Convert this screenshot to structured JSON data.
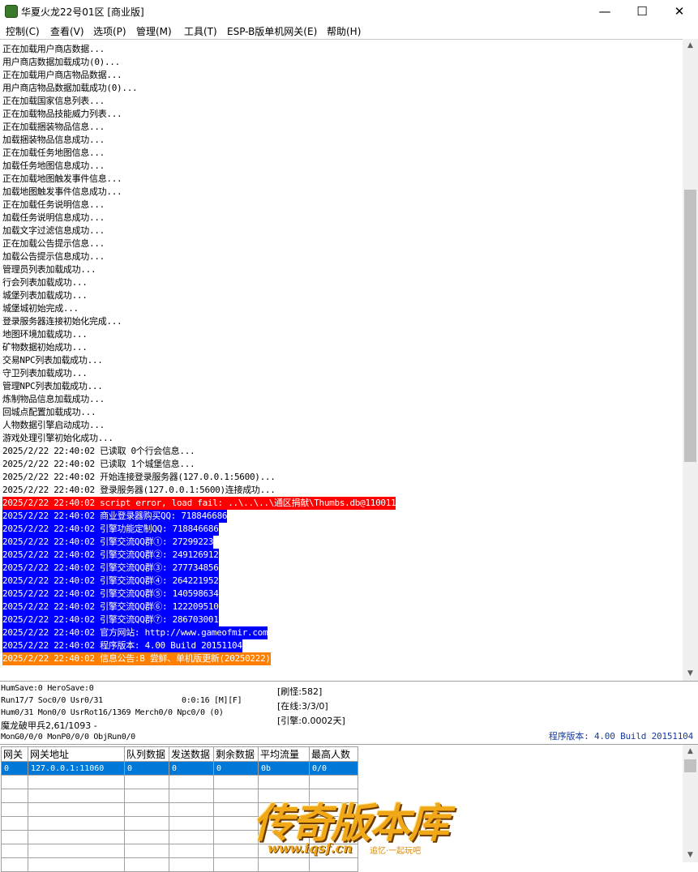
{
  "window": {
    "title": "华夏火龙22号01区 [商业版]",
    "minimize": "—",
    "maximize": "☐",
    "close": "✕"
  },
  "menu": [
    "控制(C)",
    "查看(V)",
    "选项(P)",
    "管理(M)",
    "工具(T)",
    "ESP-B版单机网关(E)",
    "帮助(H)"
  ],
  "colors": {
    "error_bg": "#ff0000",
    "info_bg": "#0000ff",
    "notice_bg": "#ff7f00",
    "selected_row": "#0078d7",
    "version_text": "#1a3c9c"
  },
  "log": [
    {
      "text": "正在加载用户商店数据...",
      "style": "normal"
    },
    {
      "text": "用户商店数据加载成功(0)...",
      "style": "normal"
    },
    {
      "text": "正在加载用户商店物品数据...",
      "style": "normal"
    },
    {
      "text": "用户商店物品数据加载成功(0)...",
      "style": "normal"
    },
    {
      "text": "正在加载国家信息列表...",
      "style": "normal"
    },
    {
      "text": "正在加载物品技能威力列表...",
      "style": "normal"
    },
    {
      "text": "正在加载捆装物品信息...",
      "style": "normal"
    },
    {
      "text": "加载捆装物品信息成功...",
      "style": "normal"
    },
    {
      "text": "正在加载任务地图信息...",
      "style": "normal"
    },
    {
      "text": "加载任务地图信息成功...",
      "style": "normal"
    },
    {
      "text": "正在加载地图触发事件信息...",
      "style": "normal"
    },
    {
      "text": "加载地图触发事件信息成功...",
      "style": "normal"
    },
    {
      "text": "正在加载任务说明信息...",
      "style": "normal"
    },
    {
      "text": "加载任务说明信息成功...",
      "style": "normal"
    },
    {
      "text": "加载文字过滤信息成功...",
      "style": "normal"
    },
    {
      "text": "正在加载公告提示信息...",
      "style": "normal"
    },
    {
      "text": "加载公告提示信息成功...",
      "style": "normal"
    },
    {
      "text": "管理员列表加载成功...",
      "style": "normal"
    },
    {
      "text": "行会列表加载成功...",
      "style": "normal"
    },
    {
      "text": "城堡列表加载成功...",
      "style": "normal"
    },
    {
      "text": "城堡城初始完成...",
      "style": "normal"
    },
    {
      "text": "登录服务器连接初始化完成...",
      "style": "normal"
    },
    {
      "text": "地图环境加载成功...",
      "style": "normal"
    },
    {
      "text": "矿物数据初始成功...",
      "style": "normal"
    },
    {
      "text": "交易NPC列表加载成功...",
      "style": "normal"
    },
    {
      "text": "守卫列表加载成功...",
      "style": "normal"
    },
    {
      "text": "管理NPC列表加载成功...",
      "style": "normal"
    },
    {
      "text": "炼制物品信息加载成功...",
      "style": "normal"
    },
    {
      "text": "回城点配置加载成功...",
      "style": "normal"
    },
    {
      "text": "人物数据引擎启动成功...",
      "style": "normal"
    },
    {
      "text": "游戏处理引擎初始化成功...",
      "style": "normal"
    },
    {
      "text": "2025/2/22 22:40:02 已读取 0个行会信息...",
      "style": "normal"
    },
    {
      "text": "2025/2/22 22:40:02 已读取 1个城堡信息...",
      "style": "normal"
    },
    {
      "text": "2025/2/22 22:40:02 开始连接登录服务器(127.0.0.1:5600)...",
      "style": "normal"
    },
    {
      "text": "2025/2/22 22:40:02 登录服务器(127.0.0.1:5600)连接成功...",
      "style": "normal"
    },
    {
      "text": "2025/2/22 22:40:02 script error, load fail: ..\\..\\..\\通区捐献\\Thumbs.db@110011",
      "style": "error"
    },
    {
      "text": "2025/2/22 22:40:02 商业登录器购买QQ: 718846686",
      "style": "info"
    },
    {
      "text": "2025/2/22 22:40:02 引擎功能定制QQ: 718846686",
      "style": "info"
    },
    {
      "text": "2025/2/22 22:40:02 引擎交流QQ群①: 27299223",
      "style": "info"
    },
    {
      "text": "2025/2/22 22:40:02 引擎交流QQ群②: 249126912",
      "style": "info"
    },
    {
      "text": "2025/2/22 22:40:02 引擎交流QQ群③: 277734856",
      "style": "info"
    },
    {
      "text": "2025/2/22 22:40:02 引擎交流QQ群④: 264221952",
      "style": "info"
    },
    {
      "text": "2025/2/22 22:40:02 引擎交流QQ群⑤: 140598634",
      "style": "info"
    },
    {
      "text": "2025/2/22 22:40:02 引擎交流QQ群⑥: 122209510",
      "style": "info"
    },
    {
      "text": "2025/2/22 22:40:02 引擎交流QQ群⑦: 286703001",
      "style": "info"
    },
    {
      "text": "2025/2/22 22:40:02 官方网站: http://www.gameofmir.com",
      "style": "info"
    },
    {
      "text": "2025/2/22 22:40:02 程序版本: 4.00 Build 20151104",
      "style": "info"
    },
    {
      "text": "2025/2/22 22:40:02 信息公告:B 尝鲜、单机版更新(20250222)",
      "style": "notice"
    }
  ],
  "status": {
    "line1": "HumSave:0 HeroSave:0",
    "line2": "Run17/7 Soc0/0 Usr0/31",
    "timer": "0:0:16 [M][F]",
    "line3": "Hum0/31 Mon0/0 UsrRot16/1369 Merch0/0 Npc0/0 (0)",
    "line4": "魔龙破甲兵2,61/1093 -",
    "line5": "MonG0/0/0 MonP0/0/0 ObjRun0/0",
    "refresh": "[刷怪:582]",
    "online": "[在线:3/3/0]",
    "engine": "[引擎:0.0002天]",
    "version": "程序版本: 4.00 Build 20151104"
  },
  "gate_table": {
    "headers": [
      "网关",
      "网关地址",
      "队列数据",
      "发送数据",
      "剩余数据",
      "平均流量",
      "最高人数"
    ],
    "rows": [
      [
        "0",
        "127.0.0.1:11060",
        "0",
        "0",
        "0",
        "0b",
        "0/0"
      ]
    ]
  },
  "watermark": {
    "title": "传奇版本库",
    "url": "www.iqsf.cn",
    "tag": "追忆·一起玩吧"
  }
}
